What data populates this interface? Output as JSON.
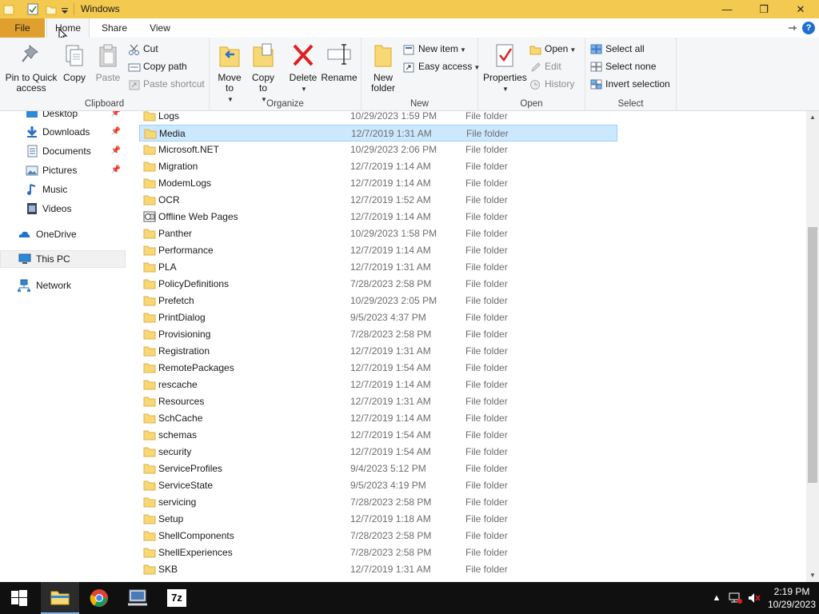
{
  "window": {
    "title": "Windows"
  },
  "titlebar": {
    "minimize": "—",
    "maximize": "❐",
    "close": "✕"
  },
  "tabs": {
    "file": "File",
    "home": "Home",
    "share": "Share",
    "view": "View",
    "help": "?"
  },
  "ribbon": {
    "clipboard": {
      "group_label": "Clipboard",
      "pin_label": "Pin to Quick access",
      "copy_label": "Copy",
      "paste_label": "Paste",
      "cut_label": "Cut",
      "copy_path_label": "Copy path",
      "paste_shortcut_label": "Paste shortcut"
    },
    "organize": {
      "group_label": "Organize",
      "move_to_label": "Move to",
      "copy_to_label": "Copy to",
      "delete_label": "Delete",
      "rename_label": "Rename"
    },
    "new": {
      "group_label": "New",
      "new_folder_label": "New folder",
      "new_item_label": "New item",
      "easy_access_label": "Easy access"
    },
    "open": {
      "group_label": "Open",
      "properties_label": "Properties",
      "open_label": "Open",
      "edit_label": "Edit",
      "history_label": "History"
    },
    "select": {
      "group_label": "Select",
      "select_all_label": "Select all",
      "select_none_label": "Select none",
      "invert_label": "Invert selection"
    }
  },
  "nav": {
    "items": [
      {
        "label": "Desktop",
        "icon": "desktop-icon",
        "pinned": true
      },
      {
        "label": "Downloads",
        "icon": "downloads-icon",
        "pinned": true
      },
      {
        "label": "Documents",
        "icon": "documents-icon",
        "pinned": true
      },
      {
        "label": "Pictures",
        "icon": "pictures-icon",
        "pinned": true
      },
      {
        "label": "Music",
        "icon": "music-icon",
        "pinned": false
      },
      {
        "label": "Videos",
        "icon": "videos-icon",
        "pinned": false
      },
      {
        "label": "OneDrive",
        "icon": "onedrive-icon",
        "pinned": false
      },
      {
        "label": "This PC",
        "icon": "this-pc-icon",
        "pinned": false,
        "selected": true
      },
      {
        "label": "Network",
        "icon": "network-icon",
        "pinned": false
      }
    ],
    "pin_glyph": "📌"
  },
  "files": [
    {
      "name": "Logs",
      "date": "10/29/2023 1:59 PM",
      "type": "File folder"
    },
    {
      "name": "Media",
      "date": "12/7/2019 1:31 AM",
      "type": "File folder",
      "selected": true
    },
    {
      "name": "Microsoft.NET",
      "date": "10/29/2023 2:06 PM",
      "type": "File folder"
    },
    {
      "name": "Migration",
      "date": "12/7/2019 1:14 AM",
      "type": "File folder"
    },
    {
      "name": "ModemLogs",
      "date": "12/7/2019 1:14 AM",
      "type": "File folder"
    },
    {
      "name": "OCR",
      "date": "12/7/2019 1:52 AM",
      "type": "File folder"
    },
    {
      "name": "Offline Web Pages",
      "date": "12/7/2019 1:14 AM",
      "type": "File folder",
      "special": true
    },
    {
      "name": "Panther",
      "date": "10/29/2023 1:58 PM",
      "type": "File folder"
    },
    {
      "name": "Performance",
      "date": "12/7/2019 1:14 AM",
      "type": "File folder"
    },
    {
      "name": "PLA",
      "date": "12/7/2019 1:31 AM",
      "type": "File folder"
    },
    {
      "name": "PolicyDefinitions",
      "date": "7/28/2023 2:58 PM",
      "type": "File folder"
    },
    {
      "name": "Prefetch",
      "date": "10/29/2023 2:05 PM",
      "type": "File folder"
    },
    {
      "name": "PrintDialog",
      "date": "9/5/2023 4:37 PM",
      "type": "File folder"
    },
    {
      "name": "Provisioning",
      "date": "7/28/2023 2:58 PM",
      "type": "File folder"
    },
    {
      "name": "Registration",
      "date": "12/7/2019 1:31 AM",
      "type": "File folder"
    },
    {
      "name": "RemotePackages",
      "date": "12/7/2019 1:54 AM",
      "type": "File folder"
    },
    {
      "name": "rescache",
      "date": "12/7/2019 1:14 AM",
      "type": "File folder"
    },
    {
      "name": "Resources",
      "date": "12/7/2019 1:31 AM",
      "type": "File folder"
    },
    {
      "name": "SchCache",
      "date": "12/7/2019 1:14 AM",
      "type": "File folder"
    },
    {
      "name": "schemas",
      "date": "12/7/2019 1:54 AM",
      "type": "File folder"
    },
    {
      "name": "security",
      "date": "12/7/2019 1:54 AM",
      "type": "File folder"
    },
    {
      "name": "ServiceProfiles",
      "date": "9/4/2023 5:12 PM",
      "type": "File folder"
    },
    {
      "name": "ServiceState",
      "date": "9/5/2023 4:19 PM",
      "type": "File folder"
    },
    {
      "name": "servicing",
      "date": "7/28/2023 2:58 PM",
      "type": "File folder"
    },
    {
      "name": "Setup",
      "date": "12/7/2019 1:18 AM",
      "type": "File folder"
    },
    {
      "name": "ShellComponents",
      "date": "7/28/2023 2:58 PM",
      "type": "File folder"
    },
    {
      "name": "ShellExperiences",
      "date": "7/28/2023 2:58 PM",
      "type": "File folder"
    },
    {
      "name": "SKB",
      "date": "12/7/2019 1:31 AM",
      "type": "File folder"
    }
  ],
  "taskbar": {
    "apps": [
      "start-icon",
      "file-explorer-icon",
      "chrome-icon",
      "network-app-icon",
      "7zip-icon"
    ],
    "sevenzip_label": "7z",
    "clock": {
      "time": "2:19 PM",
      "date": "10/29/2023"
    }
  },
  "colors": {
    "titlebar": "#f3c94f",
    "file_tab": "#e0a02e",
    "selection": "#cce8ff",
    "folder": "#f8d775",
    "taskbar": "#101010"
  }
}
